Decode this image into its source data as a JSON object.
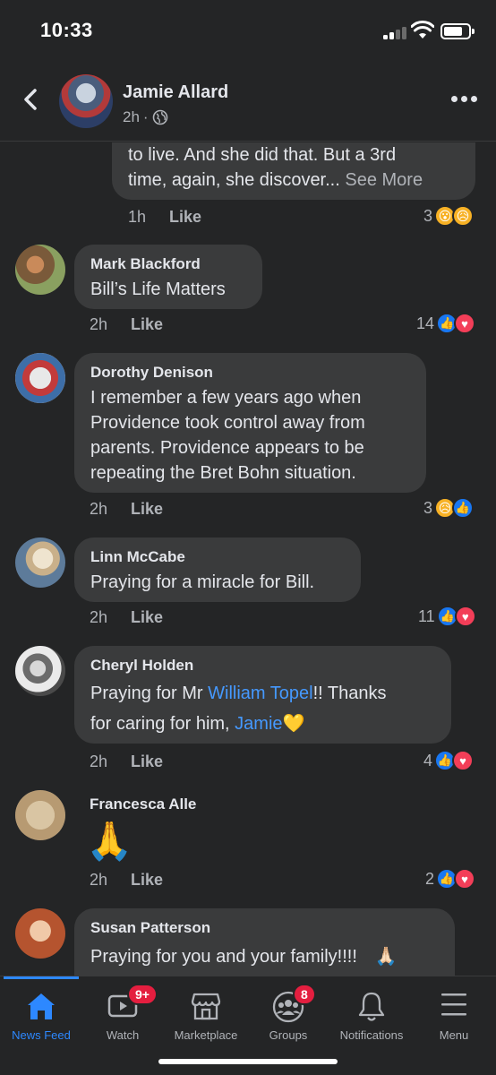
{
  "status": {
    "time": "10:33"
  },
  "header": {
    "name": "Jamie Allard",
    "time": "2h",
    "separator": "·"
  },
  "top_comment": {
    "line1": "to live. And she did that. But a 3rd",
    "line2": "time, again, she discover...",
    "see_more": "See More",
    "time": "1h",
    "like": "Like",
    "count": "3"
  },
  "comments": [
    {
      "author": "Mark Blackford",
      "text": "Bill’s Life Matters",
      "time": "2h",
      "like": "Like",
      "count": "14"
    },
    {
      "author": "Dorothy Denison",
      "lines": [
        "I remember a few years ago when",
        "Providence took control away from",
        "parents.  Providence appears to be",
        "repeating the Bret Bohn situation."
      ],
      "time": "2h",
      "like": "Like",
      "count": "3"
    },
    {
      "author": "Linn McCabe",
      "text": "Praying for a miracle for Bill.",
      "time": "2h",
      "like": "Like",
      "count": "11"
    },
    {
      "author": "Cheryl Holden",
      "text_a": "Praying for Mr ",
      "mention1": "William Topel",
      "text_b": "!!  Thanks",
      "text_c": "for caring for him, ",
      "mention2": "Jamie",
      "emoji": "💛",
      "time": "2h",
      "like": "Like",
      "count": "4"
    },
    {
      "author": "Francesca Alle",
      "emoji": "🙏",
      "time": "2h",
      "like": "Like",
      "count": "2"
    },
    {
      "author": "Susan Patterson",
      "text": "Praying for you and your family!!!!",
      "emoji": "🙏🏻"
    }
  ],
  "tabs": [
    {
      "label": "News Feed"
    },
    {
      "label": "Watch",
      "badge": "9+"
    },
    {
      "label": "Marketplace"
    },
    {
      "label": "Groups",
      "badge": "8"
    },
    {
      "label": "Notifications"
    },
    {
      "label": "Menu"
    }
  ],
  "colors": {
    "background": "#242526",
    "bubble": "#3a3b3c",
    "accent": "#2d88ff",
    "link": "#4599ff",
    "badge": "#e41e3f"
  }
}
